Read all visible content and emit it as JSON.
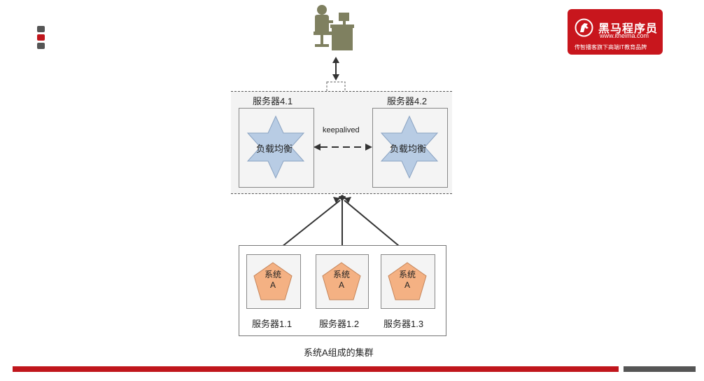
{
  "logo": {
    "brand": "黑马程序员",
    "url": "www.itheima.com",
    "slogan": "传智播客旗下高端IT教育品牌"
  },
  "diagram": {
    "lb_servers": [
      {
        "label": "服务器4.1",
        "role": "负载均衡"
      },
      {
        "label": "服务器4.2",
        "role": "负载均衡"
      }
    ],
    "link_label": "keepalived",
    "nodes": [
      {
        "label": "服务器1.1",
        "app_line1": "系统",
        "app_line2": "A"
      },
      {
        "label": "服务器1.2",
        "app_line1": "系统",
        "app_line2": "A"
      },
      {
        "label": "服务器1.3",
        "app_line1": "系统",
        "app_line2": "A"
      }
    ],
    "caption": "系统A组成的集群"
  },
  "colors": {
    "brand_red": "#c0161c",
    "star_fill": "#b8cce4",
    "pentagon_fill": "#f4b183",
    "user_icon": "#7f8060"
  },
  "icons": [
    "user-at-computer-icon",
    "horse-logo-icon",
    "star-icon",
    "pentagon-icon"
  ]
}
